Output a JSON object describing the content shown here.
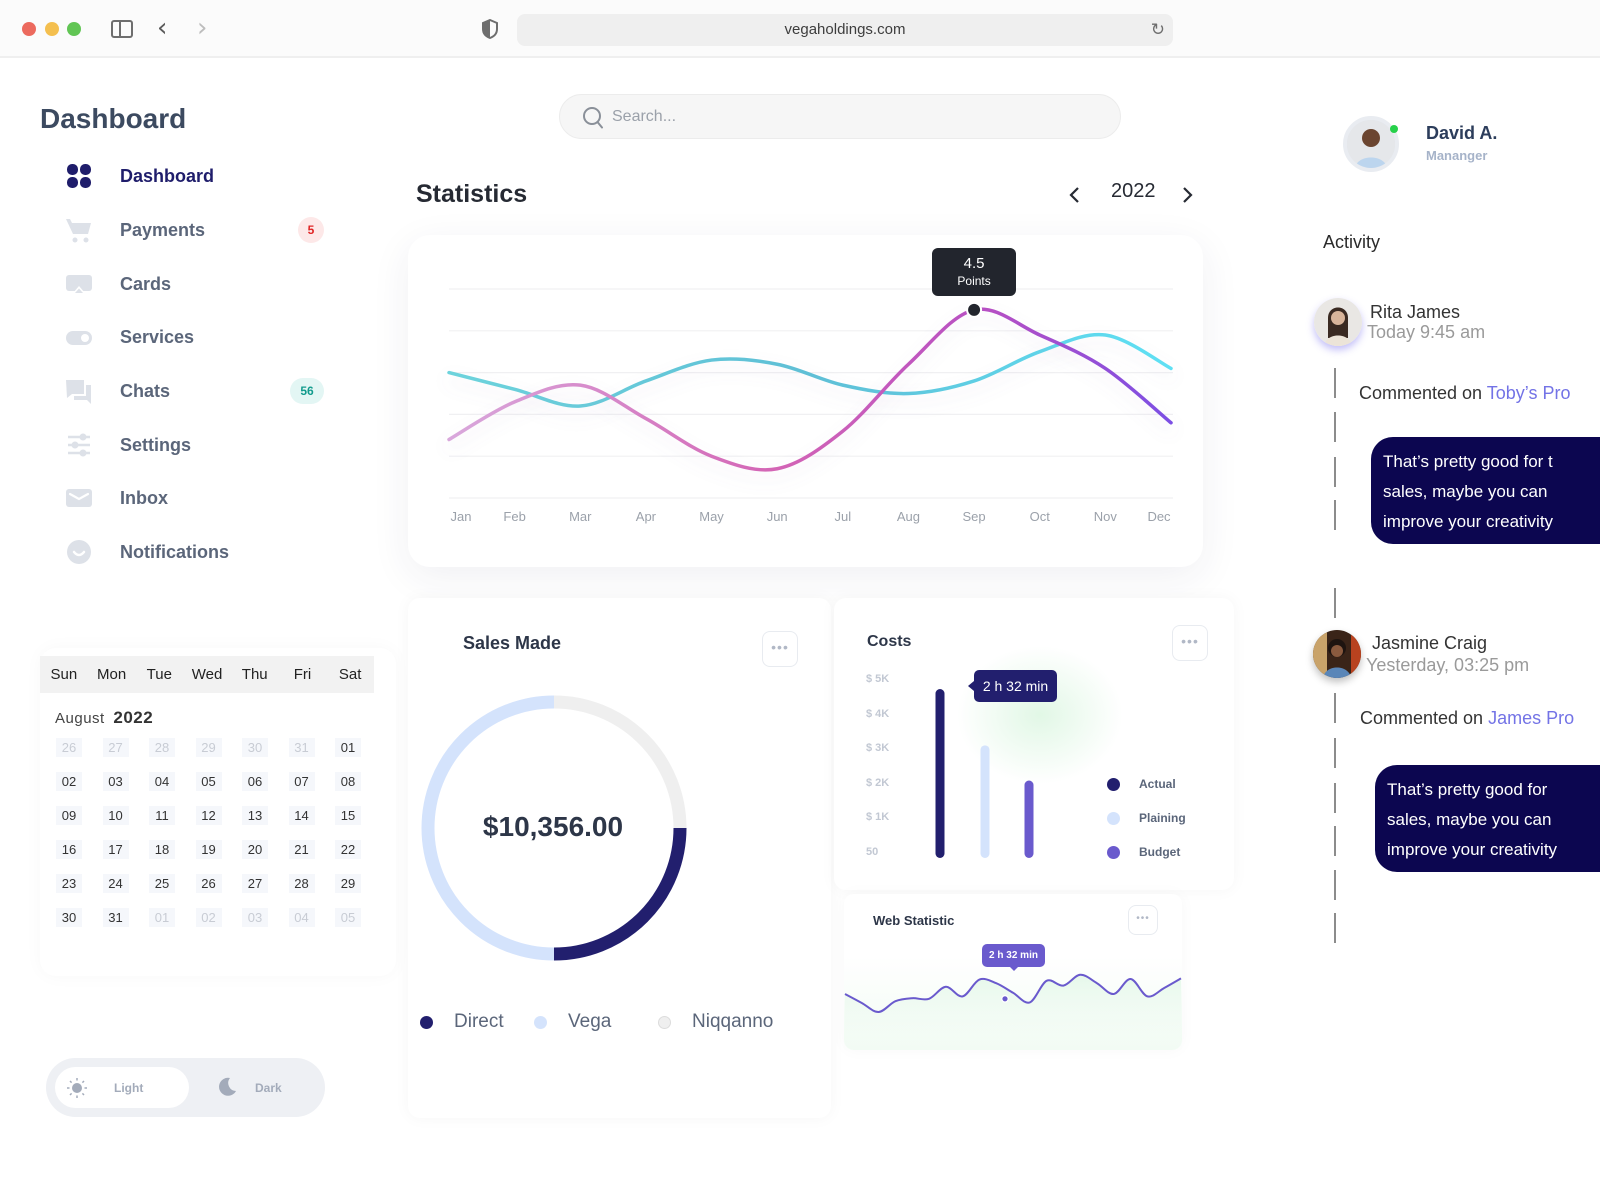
{
  "browser": {
    "url": "vegaholdings.com",
    "icons": {
      "sidebar": "sidebar-toggle-icon",
      "back": "chevron-left-icon",
      "forward": "chevron-right-icon",
      "privacy": "shield-icon",
      "reload": "reload-icon"
    },
    "back_glyph": "‹",
    "forward_glyph": "›",
    "reload_glyph": "↻"
  },
  "sidebar": {
    "title": "Dashboard",
    "items": [
      {
        "label": "Dashboard",
        "icon": "grid-icon",
        "active": true
      },
      {
        "label": "Payments",
        "icon": "cart-icon",
        "badge": "5"
      },
      {
        "label": "Cards",
        "icon": "card-icon"
      },
      {
        "label": "Services",
        "icon": "toggle-icon"
      },
      {
        "label": "Chats",
        "icon": "chat-icon",
        "badge": "56"
      },
      {
        "label": "Settings",
        "icon": "sliders-icon"
      },
      {
        "label": "Inbox",
        "icon": "mail-icon"
      },
      {
        "label": "Notifications",
        "icon": "bell-icon"
      }
    ]
  },
  "calendar": {
    "weekdays": [
      "Sun",
      "Mon",
      "Tue",
      "Wed",
      "Thu",
      "Fri",
      "Sat"
    ],
    "month": "August",
    "year": "2022",
    "days": [
      {
        "d": "26",
        "muted": true
      },
      {
        "d": "27",
        "muted": true
      },
      {
        "d": "28",
        "muted": true
      },
      {
        "d": "29",
        "muted": true
      },
      {
        "d": "30",
        "muted": true
      },
      {
        "d": "31",
        "muted": true
      },
      {
        "d": "01"
      },
      {
        "d": "02"
      },
      {
        "d": "03"
      },
      {
        "d": "04"
      },
      {
        "d": "05"
      },
      {
        "d": "06"
      },
      {
        "d": "07"
      },
      {
        "d": "08"
      },
      {
        "d": "09"
      },
      {
        "d": "10"
      },
      {
        "d": "11"
      },
      {
        "d": "12"
      },
      {
        "d": "13"
      },
      {
        "d": "14"
      },
      {
        "d": "15"
      },
      {
        "d": "16"
      },
      {
        "d": "17"
      },
      {
        "d": "18"
      },
      {
        "d": "19"
      },
      {
        "d": "20"
      },
      {
        "d": "21"
      },
      {
        "d": "22"
      },
      {
        "d": "23"
      },
      {
        "d": "24"
      },
      {
        "d": "25"
      },
      {
        "d": "26"
      },
      {
        "d": "27"
      },
      {
        "d": "28"
      },
      {
        "d": "29"
      },
      {
        "d": "30"
      },
      {
        "d": "31"
      },
      {
        "d": "01",
        "muted": true
      },
      {
        "d": "02",
        "muted": true
      },
      {
        "d": "03",
        "muted": true
      },
      {
        "d": "04",
        "muted": true
      },
      {
        "d": "05",
        "muted": true
      }
    ]
  },
  "theme": {
    "light_label": "Light",
    "dark_label": "Dark",
    "selected": "Light"
  },
  "search": {
    "placeholder": "Search...",
    "value": ""
  },
  "statistics": {
    "title": "Statistics",
    "year": "2022",
    "tooltip_value": "4.5",
    "tooltip_unit": "Points"
  },
  "sales": {
    "title": "Sales Made",
    "total": "$10,356.00",
    "menu_glyph": "•••"
  },
  "costs": {
    "title": "Costs",
    "tooltip": "2 h 32 min",
    "menu_glyph": "•••"
  },
  "web_statistic": {
    "title": "Web Statistic",
    "tooltip": "2 h 32 min",
    "menu_glyph": "•••"
  },
  "profile": {
    "name": "David A.",
    "role": "Mananger",
    "status": "online"
  },
  "activity": {
    "title": "Activity",
    "entries": [
      {
        "name": "Rita James",
        "time": "Today 9:45 am",
        "comment_prefix": "Commented on ",
        "comment_link": "Toby’s Pro",
        "message_lines": [
          "That’s pretty good for t",
          "sales, maybe you can",
          "improve your creativity"
        ]
      },
      {
        "name": "Jasmine Craig",
        "time": "Yesterday, 03:25 pm",
        "comment_prefix": "Commented on ",
        "comment_link": "James Pro",
        "message_lines": [
          "That’s pretty good for",
          "sales, maybe you can",
          "improve your creativity"
        ]
      }
    ]
  },
  "colors": {
    "primary": "#1f1d6b",
    "direct": "#221f6e",
    "vega": "#d4e3fc",
    "niqqanno": "#efefef",
    "budget": "#6a5acd",
    "series_purple": "#b04fc8",
    "series_cyan": "#5bc8d8",
    "bubble": "#0c0650"
  },
  "chart_data": [
    {
      "type": "line",
      "title": "Statistics",
      "categories": [
        "Jan",
        "Feb",
        "Mar",
        "Apr",
        "May",
        "Jun",
        "Jul",
        "Aug",
        "Sep",
        "Oct",
        "Nov",
        "Dec"
      ],
      "series": [
        {
          "name": "Series A (pink-purple)",
          "values": [
            1.4,
            2.3,
            2.7,
            1.9,
            1.0,
            0.7,
            1.6,
            3.2,
            4.5,
            3.9,
            3.1,
            1.8
          ]
        },
        {
          "name": "Series B (cyan)",
          "values": [
            3.0,
            2.6,
            2.2,
            2.8,
            3.3,
            3.2,
            2.7,
            2.5,
            2.8,
            3.5,
            3.9,
            3.1
          ]
        }
      ],
      "ylim": [
        0,
        5
      ],
      "grid": true,
      "annotations": [
        {
          "x": "Sep",
          "series": 0,
          "text": "4.5 Points"
        }
      ]
    },
    {
      "type": "pie",
      "title": "Sales Made",
      "center_label": "$10,356.00",
      "labels": [
        "Direct",
        "Vega",
        "Niqqanno"
      ],
      "values": [
        25,
        50,
        25
      ],
      "legend": "bottom"
    },
    {
      "type": "bar",
      "title": "Costs",
      "categories": [
        "Actual",
        "Plaining",
        "Budget"
      ],
      "values": [
        4800,
        3200,
        2200
      ],
      "yticks": [
        "$ 5K",
        "$ 4K",
        "$ 3K",
        "$ 2K",
        "$ 1K",
        "50"
      ],
      "ylim": [
        0,
        5000
      ],
      "legend": "right",
      "annotations": [
        {
          "x": "Actual",
          "text": "2 h 32 min"
        }
      ]
    },
    {
      "type": "area",
      "title": "Web Statistic",
      "x": [
        0,
        1,
        2,
        3,
        4,
        5,
        6,
        7,
        8,
        9,
        10,
        11,
        12,
        13,
        14,
        15,
        16,
        17,
        18,
        19,
        20
      ],
      "values": [
        5,
        3.5,
        2,
        3.8,
        4.3,
        4.2,
        6.2,
        4.6,
        7.4,
        6.8,
        5.2,
        3.6,
        7.2,
        6.4,
        8.2,
        6.8,
        5.0,
        7.5,
        4.6,
        6.0,
        7.6
      ],
      "ylim": [
        0,
        10
      ],
      "annotations": [
        {
          "x": 10,
          "text": "2 h 32 min"
        }
      ]
    }
  ]
}
